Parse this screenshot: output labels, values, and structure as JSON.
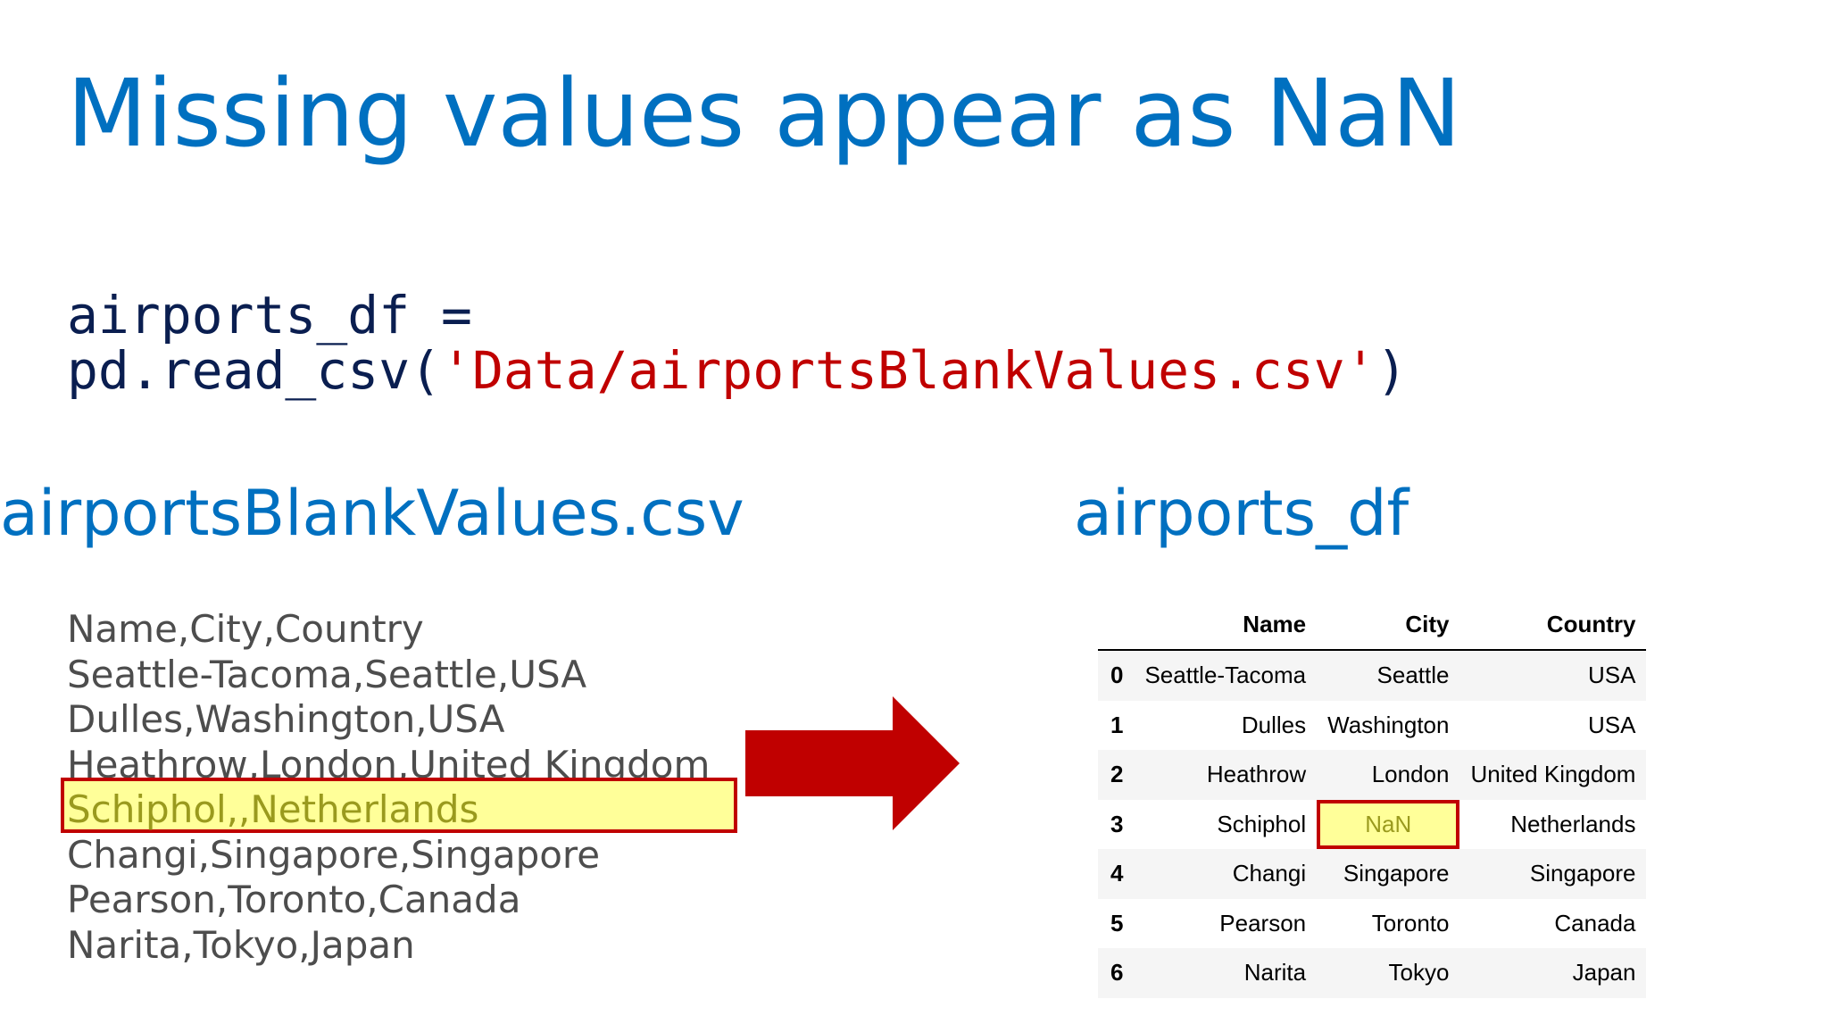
{
  "title": "Missing values appear as NaN",
  "code": {
    "line1": "airports_df =",
    "line2_prefix": "pd.read_csv(",
    "line2_string": "'Data/airportsBlankValues.csv'",
    "line2_suffix": ")"
  },
  "csv_section": {
    "label": "airportsBlankValues.csv",
    "lines": [
      "Name,City,Country",
      "Seattle-Tacoma,Seattle,USA",
      "Dulles,Washington,USA",
      "Heathrow,London,United Kingdom",
      "Schiphol,,Netherlands",
      "Changi,Singapore,Singapore",
      "Pearson,Toronto,Canada",
      "Narita,Tokyo,Japan"
    ],
    "highlighted_line_index": 4
  },
  "df_section": {
    "label": "airports_df",
    "columns": [
      "",
      "Name",
      "City",
      "Country"
    ],
    "rows": [
      [
        "0",
        "Seattle-Tacoma",
        "Seattle",
        "USA"
      ],
      [
        "1",
        "Dulles",
        "Washington",
        "USA"
      ],
      [
        "2",
        "Heathrow",
        "London",
        "United Kingdom"
      ],
      [
        "3",
        "Schiphol",
        "NaN",
        "Netherlands"
      ],
      [
        "4",
        "Changi",
        "Singapore",
        "Singapore"
      ],
      [
        "5",
        "Pearson",
        "Toronto",
        "Canada"
      ],
      [
        "6",
        "Narita",
        "Tokyo",
        "Japan"
      ]
    ]
  },
  "colors": {
    "title_blue": "#0070c0",
    "code_navy": "#0a1e50",
    "code_string_red": "#c00000",
    "highlight_yellow": "#ffff99",
    "highlight_border": "#c00000",
    "arrow_red": "#c00000",
    "csv_text_gray": "#4d4d4d"
  },
  "icons": {
    "arrow": "right-arrow-icon"
  }
}
